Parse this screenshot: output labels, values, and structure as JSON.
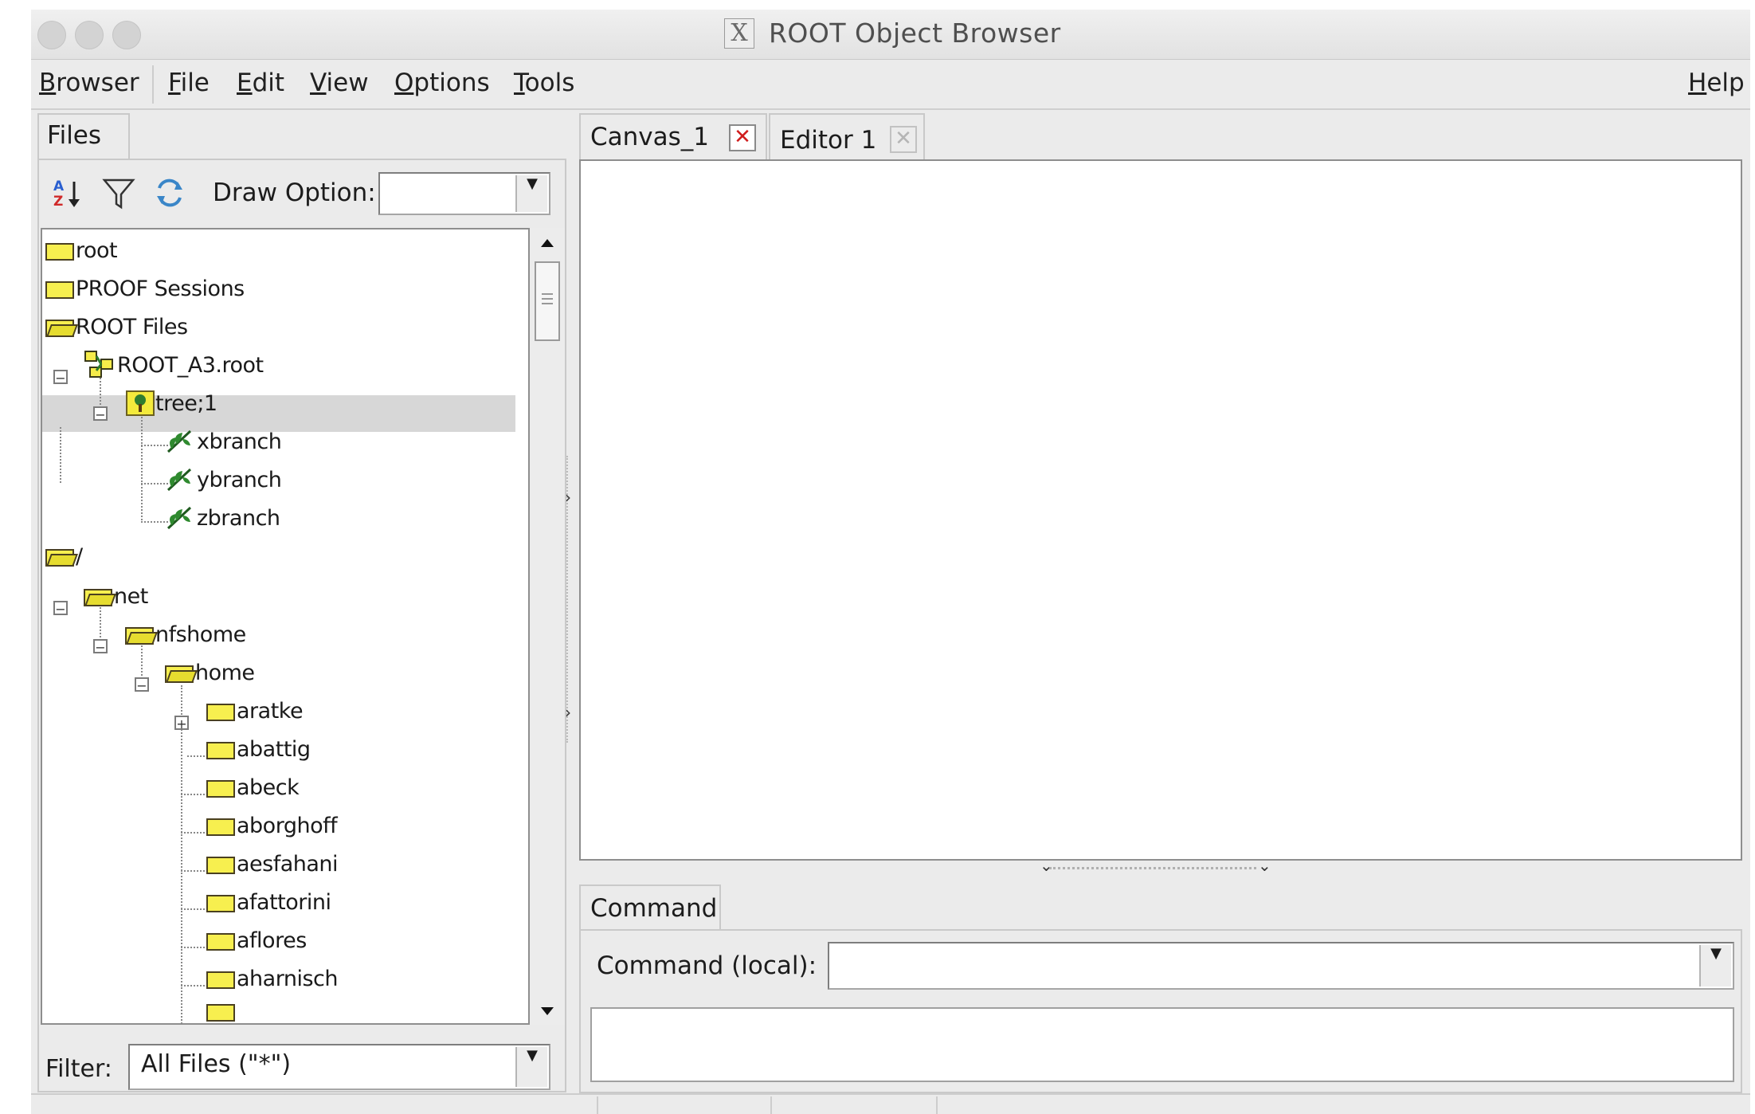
{
  "window": {
    "title": "ROOT Object Browser"
  },
  "menubar": {
    "items": [
      {
        "mnemonic": "B",
        "rest": "rowser"
      },
      {
        "mnemonic": "F",
        "rest": "ile"
      },
      {
        "mnemonic": "E",
        "rest": "dit"
      },
      {
        "mnemonic": "V",
        "rest": "iew"
      },
      {
        "mnemonic": "O",
        "rest": "ptions"
      },
      {
        "mnemonic": "T",
        "rest": "ools"
      }
    ],
    "help": {
      "mnemonic": "H",
      "rest": "elp"
    }
  },
  "left_panel": {
    "tab": "Files",
    "draw_option_label": "Draw Option:",
    "draw_option_value": "",
    "tree": [
      {
        "label": "root"
      },
      {
        "label": "PROOF Sessions"
      },
      {
        "label": "ROOT Files"
      },
      {
        "label": "ROOT_A3.root"
      },
      {
        "label": "tree;1"
      },
      {
        "label": "xbranch"
      },
      {
        "label": "ybranch"
      },
      {
        "label": "zbranch"
      },
      {
        "label": "/"
      },
      {
        "label": "net"
      },
      {
        "label": "nfshome"
      },
      {
        "label": "home"
      },
      {
        "label": "aratke"
      },
      {
        "label": "abattig"
      },
      {
        "label": "abeck"
      },
      {
        "label": "aborghoff"
      },
      {
        "label": "aesfahani"
      },
      {
        "label": "afattorini"
      },
      {
        "label": "aflores"
      },
      {
        "label": "aharnisch"
      }
    ],
    "filter_label": "Filter:",
    "filter_value": "All Files (\"*\")"
  },
  "right_panel": {
    "tabs": [
      {
        "label": "Canvas_1"
      },
      {
        "label": "Editor 1"
      }
    ],
    "command_tab": "Command",
    "command_label": "Command (local):",
    "command_value": ""
  }
}
